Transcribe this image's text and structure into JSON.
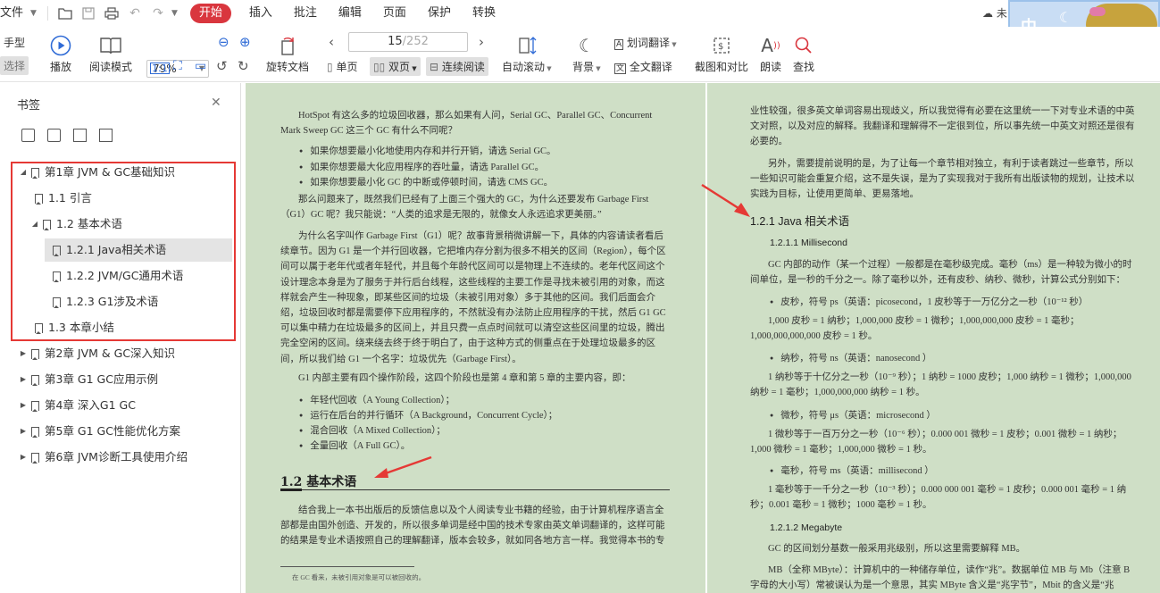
{
  "menubar": {
    "file": "文件",
    "active_tab": "开始",
    "tabs": [
      "插入",
      "批注",
      "编辑",
      "页面",
      "保护",
      "转换"
    ],
    "cloud_text": "未"
  },
  "toolbar": {
    "hand_label": "手型",
    "select_label": "选择",
    "play_label": "播放",
    "read_mode_label": "阅读模式",
    "zoom_value": "79%",
    "rotate_label": "旋转文档",
    "page_current": "15",
    "page_total": "/252",
    "single_label": "单页",
    "double_label": "双页",
    "continuous_label": "连续阅读",
    "autoscroll_label": "自动滚动",
    "background_label": "背景",
    "word_translate_label": "划词翻译",
    "full_translate_label": "全文翻译",
    "screenshot_label": "截图和对比",
    "read_aloud_label": "朗读",
    "find_label": "查找"
  },
  "avatar": {
    "char": "中"
  },
  "sidebar": {
    "title": "书签",
    "items": [
      {
        "label": "第1章 JVM & GC基础知识",
        "level": 0,
        "expanded": true
      },
      {
        "label": "1.1 引言",
        "level": 1
      },
      {
        "label": "1.2 基本术语",
        "level": 1,
        "expanded": true
      },
      {
        "label": "1.2.1 Java相关术语",
        "level": 2,
        "selected": true
      },
      {
        "label": "1.2.2 JVM/GC通用术语",
        "level": 2
      },
      {
        "label": "1.2.3 G1涉及术语",
        "level": 2
      },
      {
        "label": "1.3 本章小结",
        "level": 1
      },
      {
        "label": "第2章 JVM & GC深入知识",
        "level": 0
      },
      {
        "label": "第3章 G1 GC应用示例",
        "level": 0
      },
      {
        "label": "第4章 深入G1 GC",
        "level": 0
      },
      {
        "label": "第5章 G1 GC性能优化方案",
        "level": 0
      },
      {
        "label": "第6章 JVM诊断工具使用介绍",
        "level": 0
      }
    ]
  },
  "left_page": {
    "p1": "HotSpot 有这么多的垃圾回收器，那么如果有人问，Serial GC、Parallel GC、Concurrent Mark Sweep GC 这三个 GC 有什么不同呢？",
    "b1": [
      "如果你想要最小化地使用内存和并行开销，请选 Serial GC。",
      "如果你想要最大化应用程序的吞吐量，请选 Parallel GC。",
      "如果你想要最小化 GC 的中断或停顿时间，请选 CMS GC。"
    ],
    "p2": "那么问题来了，既然我们已经有了上面三个强大的 GC，为什么还要发布 Garbage First（G1）GC 呢？我只能说：“人类的追求是无限的，就像女人永远追求更美丽。”",
    "p3": "为什么名字叫作 Garbage First（G1）呢？故事背景稍微讲解一下，具体的内容请读者看后续章节。因为 G1 是一个并行回收器，它把堆内存分割为很多不相关的区间（Region），每个区间可以属于老年代或者年轻代，并且每个年龄代区间可以是物理上不连续的。老年代区间这个设计理念本身是为了服务于并行后台线程，这些线程的主要工作是寻找未被引用的对象，而这样就会产生一种现象，即某些区间的垃圾（未被引用对象）多于其他的区间。我们后面会介绍，垃圾回收时都是需要停下应用程序的，不然就没有办法防止应用程序的干扰，然后 G1 GC 可以集中精力在垃圾最多的区间上，并且只费一点点时间就可以清空这些区间里的垃圾，腾出完全空闲的区间。绕来绕去终于终于明白了，由于这种方式的侧重点在于处理垃圾最多的区间，所以我们给 G1 一个名字：垃圾优先（Garbage First）。",
    "p4": "G1 内部主要有四个操作阶段，这四个阶段也是第 4 章和第 5 章的主要内容，即：",
    "b2": [
      "年轻代回收（A Young Collection）；",
      "运行在后台的并行循环（A Background，Concurrent Cycle）；",
      "混合回收（A Mixed Collection）；",
      "全量回收（A Full GC）。"
    ],
    "h12": "1.2 基本术语",
    "p5": "结合我上一本书出版后的反馈信息以及个人阅读专业书籍的经验，由于计算机程序语言全部都是由国外创造、开发的，所以很多单词是经中国的技术专家由英文单词翻译的，这样可能的结果是专业术语按照自己的理解翻译，版本会较多，就如同各地方言一样。我觉得本书的专",
    "fn": "在 GC 看来，未被引用对象是可以被回收的。"
  },
  "right_page": {
    "p1": "业性较强，很多英文单词容易出现歧义，所以我觉得有必要在这里统一一下对专业术语的中英文对照，以及对应的解释。我翻译和理解得不一定很到位，所以事先统一中英文对照还是很有必要的。",
    "p2": "另外，需要提前说明的是，为了让每一个章节相对独立，有利于读者跳过一些章节，所以一些知识可能会重复介绍，这不是失误，是为了实现我对于我所有出版读物的规划，让技术以实践为目标，让使用更简单、更易落地。",
    "h121": "1.2.1  Java 相关术语",
    "h1211": "1.2.1.1  Millisecond",
    "p3": "GC 内部的动作（某一个过程）一般都是在毫秒级完成。毫秒（ms）是一种较为微小的时间单位，是一秒的千分之一。除了毫秒以外，还有皮秒、纳秒、微秒，计算公式分别如下：",
    "b1": "皮秒，符号 ps（英语：picosecond，1 皮秒等于一万亿分之一秒（10⁻¹² 秒）",
    "p4": "1,000 皮秒 = 1 纳秒；1,000,000 皮秒 = 1 微秒；1,000,000,000 皮秒 = 1 毫秒；1,000,000,000,000 皮秒 = 1 秒。",
    "b2": "纳秒，符号 ns（英语：nanosecond ）",
    "p5": "1 纳秒等于十亿分之一秒（10⁻⁹ 秒）；1 纳秒 = 1000 皮秒；1,000 纳秒 = 1 微秒；1,000,000 纳秒 = 1 毫秒；1,000,000,000 纳秒 = 1 秒。",
    "b3": "微秒，符号 μs（英语：microsecond ）",
    "p6": "1 微秒等于一百万分之一秒（10⁻⁶ 秒）；0.000 001 微秒 = 1 皮秒；0.001 微秒 = 1 纳秒；1,000 微秒 = 1 毫秒；1,000,000 微秒 = 1 秒。",
    "b4": "毫秒，符号 ms（英语：millisecond ）",
    "p7": "1 毫秒等于一千分之一秒（10⁻³ 秒）；0.000 000 001 毫秒 = 1 皮秒；0.000 001 毫秒 = 1 纳秒；0.001 毫秒 = 1 微秒；1000 毫秒 = 1 秒。",
    "h1212": "1.2.1.2  Megabyte",
    "p8": "GC 的区间划分基数一般采用兆级别，所以这里需要解释 MB。",
    "p9": "MB（全称 MByte）：计算机中的一种储存单位，读作“兆”。数据单位 MB 与 Mb（注意 B 字母的大小写）常被误认为是一个意思，其实 MByte 含义是“兆字节”，Mbit 的含义是“兆"
  }
}
